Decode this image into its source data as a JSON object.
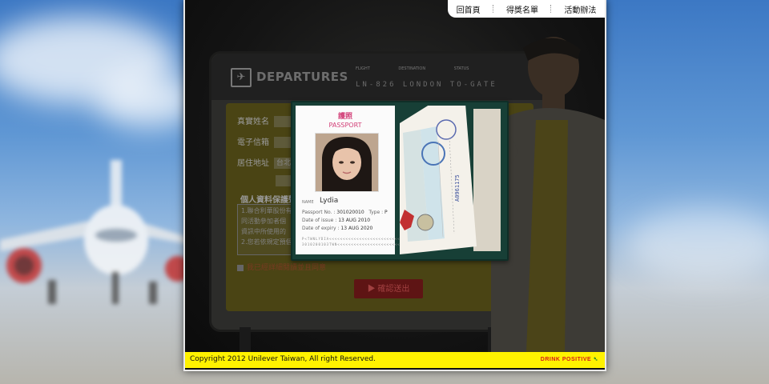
{
  "nav": {
    "items": [
      "回首頁",
      "得獎名單",
      "活動辦法"
    ]
  },
  "board": {
    "title": "DEPARTURES",
    "columns": [
      "FLIGHT",
      "DESTINATION",
      "STATUS"
    ],
    "flight_row": "LN-826 LONDON TO-GATE"
  },
  "form": {
    "labels": [
      "真實姓名",
      "電子信箱",
      "居住地址"
    ],
    "address_value": "台北",
    "terms_title": "個人資料保護聲明",
    "terms_lines": [
      "1.聯合利華股份有",
      "同活動參加者個",
      "資訊中所使用的",
      "2.您若依規定預個"
    ],
    "agree_text": "我已經詳細閱讀並且同意",
    "submit_label": "確認送出"
  },
  "passport": {
    "title_cn": "護照",
    "title_en": "PASSPORT",
    "name_label": "NAME",
    "name": "Lydia",
    "passport_no_label": "Passport No. :",
    "passport_no": "301020010",
    "type_label": "Type :",
    "type": "P",
    "issue_label": "Date of issue :",
    "issue": "13 AUG 2010",
    "expiry_label": "Date of expiry :",
    "expiry": "13 AUG 2020",
    "mrz1": "P<TWNLYDIA<<<<<<<<<<<<<<<<<<<<<<<<<<",
    "mrz2": "3010200103TWN<<<<<<<<<<<<<<<<<<<<<<<"
  },
  "footer": {
    "copyright": "Copyright 2012 Unilever Taiwan, All right Reserved.",
    "brand": "DRINK POSITIVE"
  },
  "colors": {
    "footer_bg": "#fff200",
    "passport_pink": "#d23e77",
    "modal_bg": "#173f36",
    "brand_red": "#d51c1c"
  }
}
